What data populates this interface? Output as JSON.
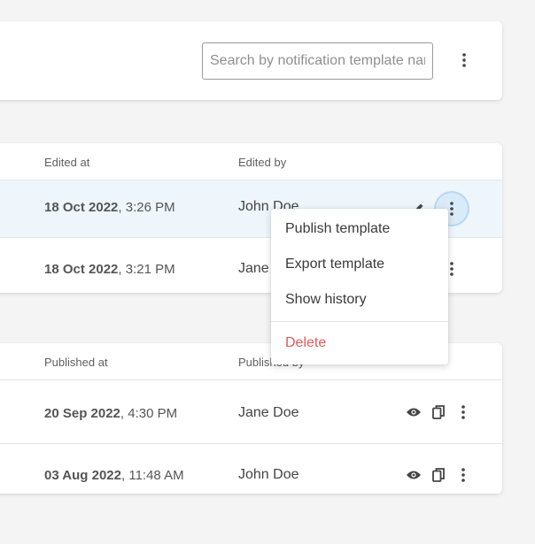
{
  "search": {
    "placeholder": "Search by notification template name"
  },
  "drafts": {
    "headers": {
      "edited_at": "Edited at",
      "edited_by": "Edited by"
    },
    "rows": [
      {
        "date": "18 Oct 2022",
        "time": ", 3:26 PM",
        "user": "John Doe"
      },
      {
        "date": "18 Oct 2022",
        "time": ", 3:21 PM",
        "user": "Jane Doe"
      }
    ]
  },
  "published": {
    "headers": {
      "published_at": "Published at",
      "published_by": "Published by"
    },
    "rows": [
      {
        "date": "20 Sep 2022",
        "time": ", 4:30 PM",
        "user": "Jane Doe"
      },
      {
        "date": "03 Aug 2022",
        "time": ", 11:48 AM",
        "user": "John Doe"
      }
    ]
  },
  "menu": {
    "items": [
      {
        "label": "Publish template"
      },
      {
        "label": "Export template"
      },
      {
        "label": "Show history"
      },
      {
        "label": "Delete"
      }
    ]
  },
  "colors": {
    "accent": "#b8d8f0",
    "highlight_row": "#eef6fc",
    "danger": "#e05a5a"
  },
  "icons": [
    "kebab-icon",
    "pencil-icon",
    "eye-icon",
    "copy-icon"
  ]
}
